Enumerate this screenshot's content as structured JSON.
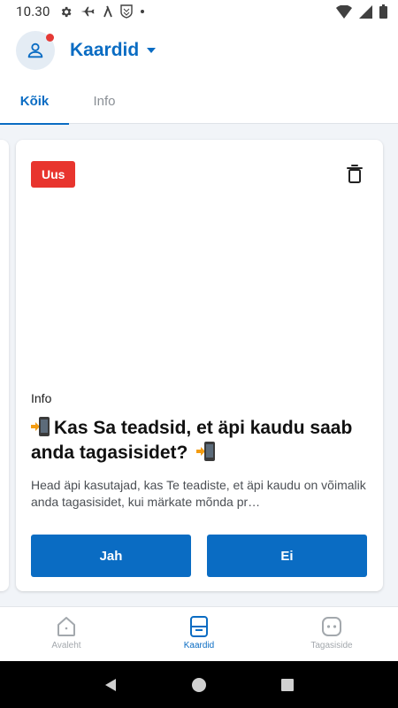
{
  "status_bar": {
    "time": "10.30"
  },
  "header": {
    "title": "Kaardid"
  },
  "tabs": [
    {
      "label": "Kõik"
    },
    {
      "label": "Info"
    }
  ],
  "card": {
    "badge": "Uus",
    "category": "Info",
    "title": "Kas Sa teadsid, et äpi kaudu saab anda tagasisidet?",
    "body": "Head äpi kasutajad, kas Te teadiste, et äpi kaudu on võimalik anda tagasisidet, kui märkate mõnda pr…",
    "yes_label": "Jah",
    "no_label": "Ei"
  },
  "bottom_nav": [
    {
      "label": "Avaleht",
      "icon": "home-icon"
    },
    {
      "label": "Kaardid",
      "icon": "cards-icon",
      "active": true
    },
    {
      "label": "Tagasiside",
      "icon": "feedback-icon"
    }
  ],
  "colors": {
    "accent": "#0a6cc3",
    "badge": "#e8352e",
    "background": "#f1f4f8"
  }
}
